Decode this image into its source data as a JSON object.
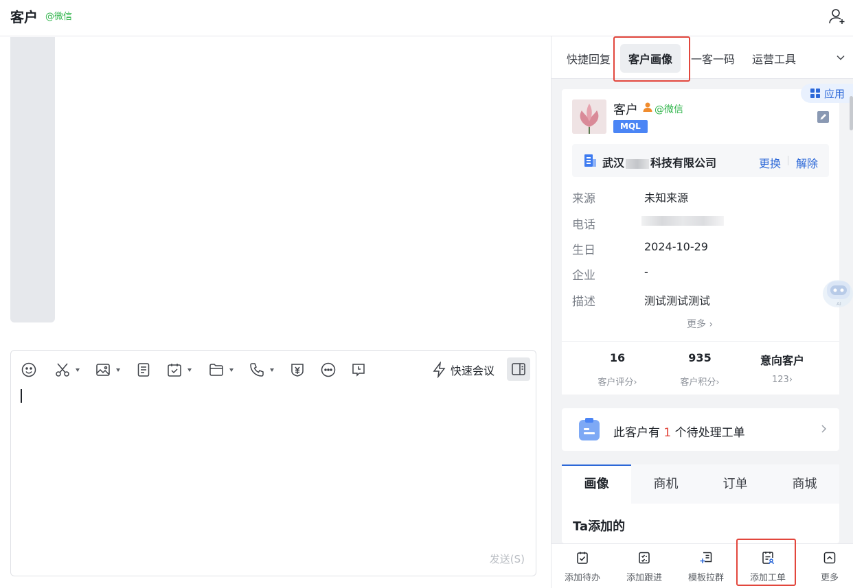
{
  "header": {
    "title": "客户",
    "channel_tag": "@微信"
  },
  "editor": {
    "toolbar": [
      "emoji-icon",
      "scissors-icon",
      "image-icon",
      "document-icon",
      "calendar-icon",
      "folder-icon",
      "phone-icon",
      "payment-icon",
      "more-icon",
      "reminder-icon"
    ],
    "quick_meeting_label": "快速会议",
    "send_label": "发送(S)"
  },
  "right_tabs": {
    "quick_reply": "快捷回复",
    "customer_portrait": "客户画像",
    "one_customer_code": "一客一码",
    "ops_tools": "运营工具"
  },
  "app_chip": "应用",
  "profile": {
    "name": "客户",
    "channel": "@微信",
    "badge": "MQL",
    "company_prefix": "武汉",
    "company_suffix": "科技有限公司",
    "change_label": "更换",
    "remove_label": "解除",
    "fields": [
      {
        "label": "来源",
        "value": "未知来源"
      },
      {
        "label": "电话",
        "value": ""
      },
      {
        "label": "生日",
        "value": "2024-10-29"
      },
      {
        "label": "企业",
        "value": "-"
      },
      {
        "label": "描述",
        "value": "测试测试测试"
      }
    ],
    "more_label": "更多",
    "stats": [
      {
        "value": "16",
        "label": "客户评分"
      },
      {
        "value": "935",
        "label": "客户积分"
      },
      {
        "value": "意向客户",
        "label": "123"
      }
    ]
  },
  "ticket": {
    "prefix": "此客户有",
    "count": "1",
    "suffix": "个待处理工单"
  },
  "portrait_tabs": [
    "画像",
    "商机",
    "订单",
    "商城"
  ],
  "ta_added_title": "Ta添加的",
  "bottom_bar": [
    "添加待办",
    "添加跟进",
    "模板拉群",
    "添加工单",
    "更多"
  ],
  "colors": {
    "accent": "#2c68d8",
    "wechat": "#2fb44a",
    "highlight_box": "#e2463c"
  }
}
